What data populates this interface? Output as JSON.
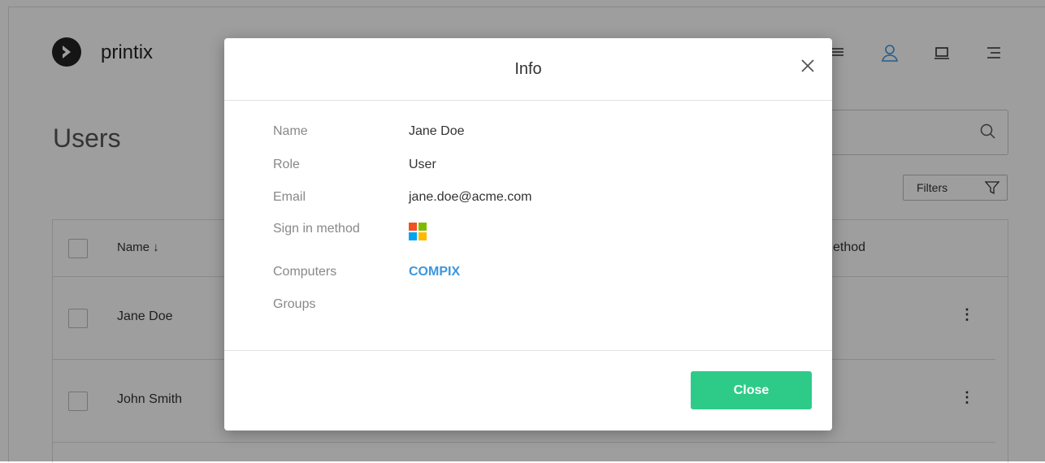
{
  "app": {
    "brand": "printix"
  },
  "page": {
    "title": "Users",
    "filters_label": "Filters",
    "table": {
      "col_name": "Name ↓",
      "col_method_partial": "ethod",
      "rows": [
        {
          "name": "Jane Doe"
        },
        {
          "name": "John Smith"
        }
      ]
    }
  },
  "modal": {
    "title": "Info",
    "fields": {
      "name_label": "Name",
      "name_value": "Jane Doe",
      "role_label": "Role",
      "role_value": "User",
      "email_label": "Email",
      "email_value": "jane.doe@acme.com",
      "signin_label": "Sign in method",
      "signin_icon": "microsoft-icon",
      "computers_label": "Computers",
      "computers_value": "COMPIX",
      "groups_label": "Groups"
    },
    "close_label": "Close"
  },
  "colors": {
    "accent_blue": "#3a97e0",
    "primary_button": "#2ecb88"
  }
}
